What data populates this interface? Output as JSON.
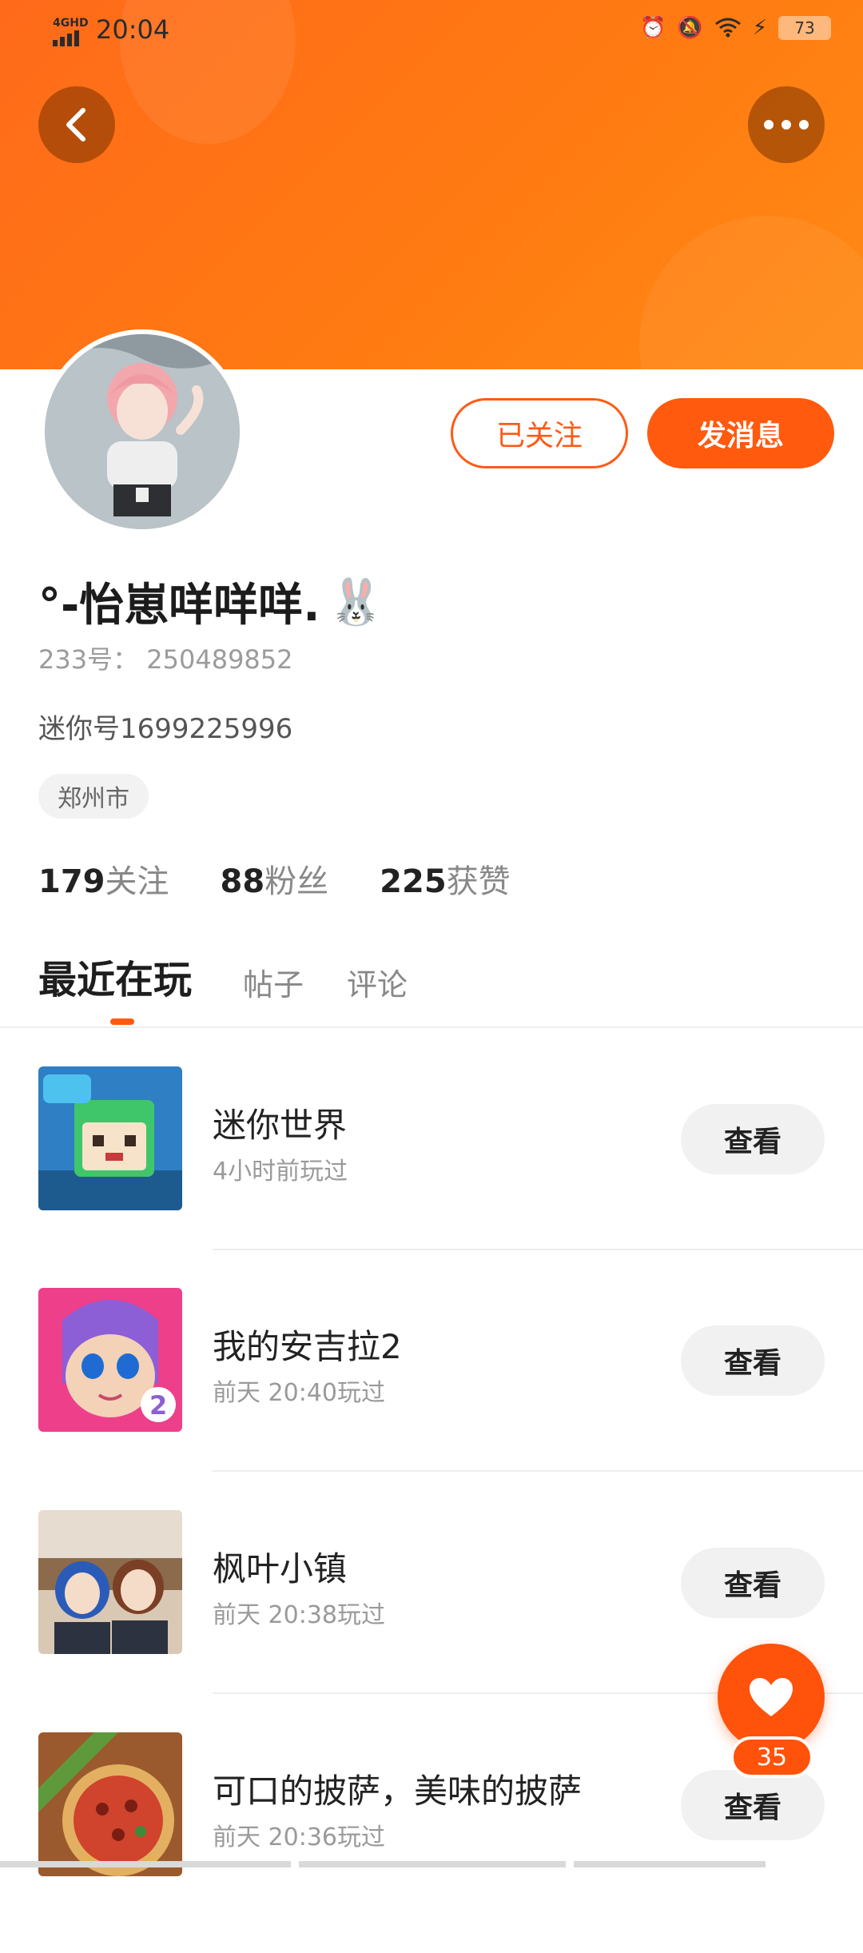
{
  "status_bar": {
    "network": "4GHD",
    "time": "20:04",
    "battery": "73",
    "icons": [
      "alarm-icon",
      "mute-icon",
      "wifi-icon",
      "charging-icon"
    ]
  },
  "header": {
    "back_icon": "chevron-left-icon",
    "more_icon": "more-dots-icon"
  },
  "profile": {
    "name": "°-怡崽咩咩咩.",
    "emoji": "🐰",
    "uid_label": "233号：",
    "uid_value": "250489852",
    "mini_id": "迷你号1699225996",
    "city": "郑州市",
    "follow_label": "已关注",
    "message_label": "发消息",
    "stats": [
      {
        "value": "179",
        "label": "关注"
      },
      {
        "value": "88",
        "label": "粉丝"
      },
      {
        "value": "225",
        "label": "获赞"
      }
    ]
  },
  "tabs": [
    {
      "label": "最近在玩",
      "active": true
    },
    {
      "label": "帖子",
      "active": false
    },
    {
      "label": "评论",
      "active": false
    }
  ],
  "games": [
    {
      "title": "迷你世界",
      "time": "4小时前玩过",
      "button": "查看"
    },
    {
      "title": "我的安吉拉2",
      "time": "前天 20:40玩过",
      "button": "查看"
    },
    {
      "title": "枫叶小镇",
      "time": "前天 20:38玩过",
      "button": "查看"
    },
    {
      "title": "可口的披萨，美味的披萨",
      "time": "前天 20:36玩过",
      "button": "查看"
    }
  ],
  "fab": {
    "count": "35",
    "icon": "heart-icon"
  },
  "colors": {
    "accent": "#ff5a0e",
    "banner": "#ff7a12"
  }
}
